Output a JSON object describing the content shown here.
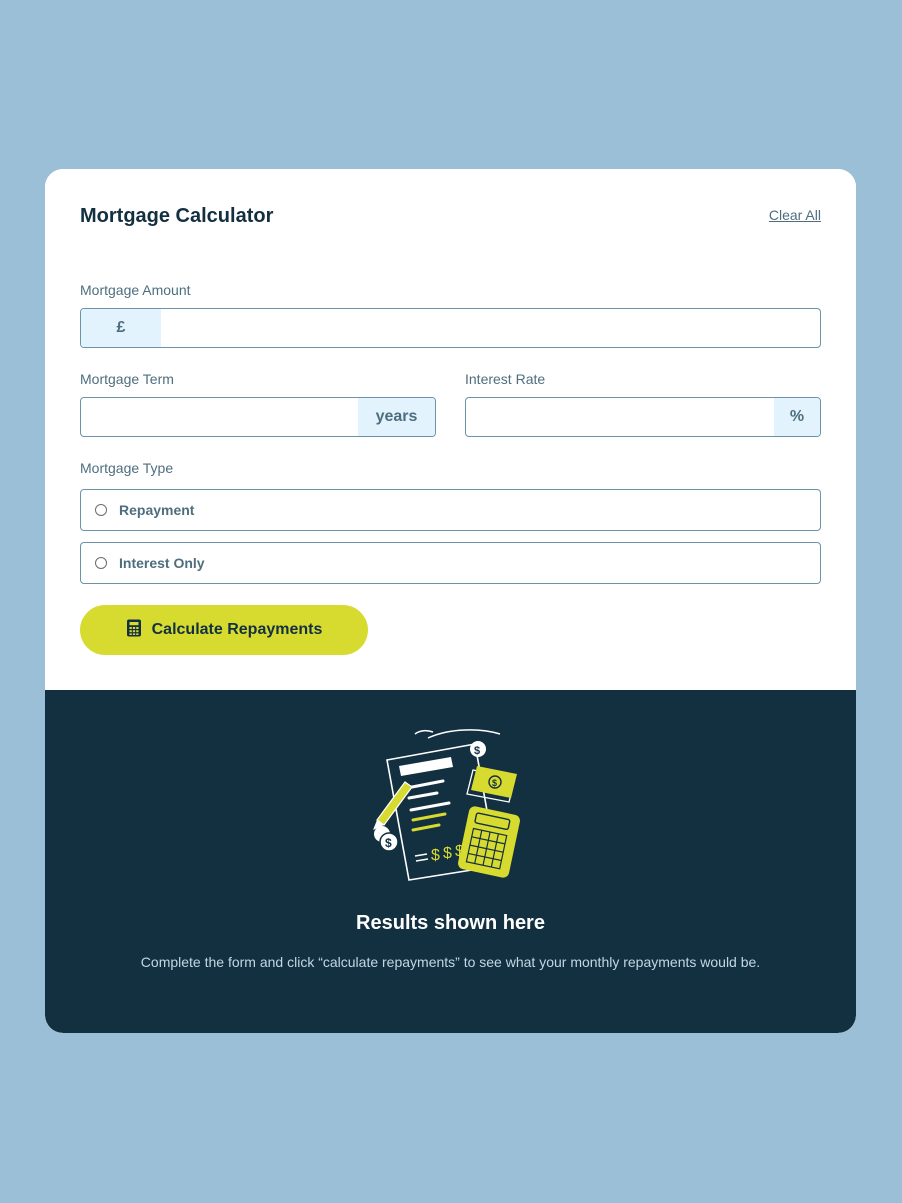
{
  "header": {
    "title": "Mortgage Calculator",
    "clear_all": "Clear All"
  },
  "fields": {
    "amount": {
      "label": "Mortgage Amount",
      "prefix": "£",
      "value": ""
    },
    "term": {
      "label": "Mortgage Term",
      "suffix": "years",
      "value": ""
    },
    "rate": {
      "label": "Interest Rate",
      "suffix": "%",
      "value": ""
    }
  },
  "mortgage_type": {
    "label": "Mortgage Type",
    "options": [
      {
        "label": "Repayment",
        "selected": false
      },
      {
        "label": "Interest Only",
        "selected": false
      }
    ]
  },
  "calculate_button": {
    "label": "Calculate Repayments",
    "icon": "calculator-icon"
  },
  "results": {
    "illustration": "empty-results-illustration",
    "title": "Results shown here",
    "description": "Complete the form and click “calculate repayments” to see what your monthly repayments would be."
  },
  "colors": {
    "background": "#9bbfd7",
    "accent": "#d8db2f",
    "dark": "#133041",
    "slate": "#4e6e7e",
    "affix_bg": "#e3f3fd"
  }
}
